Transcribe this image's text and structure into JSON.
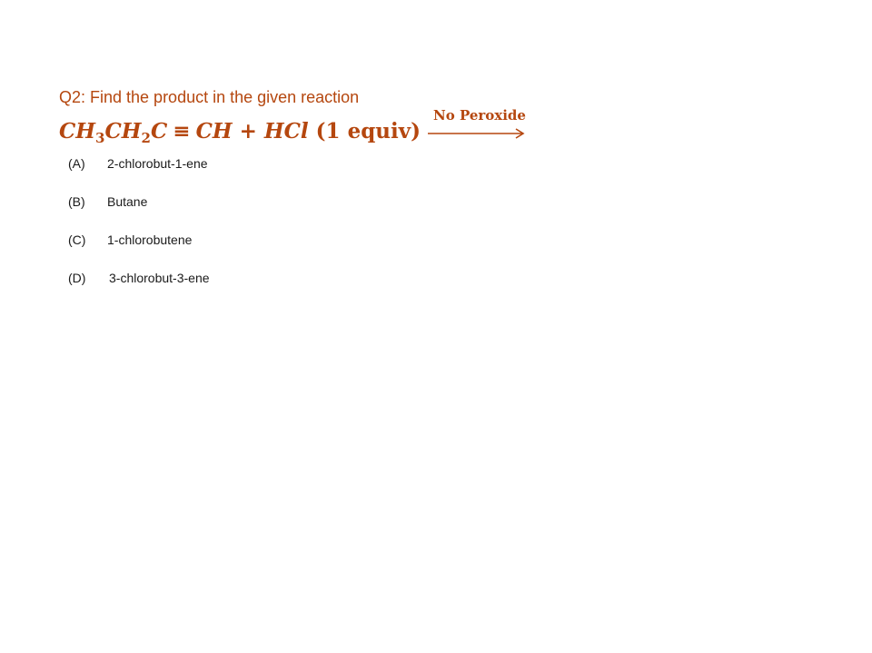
{
  "question": {
    "text": "Q2: Find the product in the given reaction"
  },
  "reaction": {
    "ch": "CH",
    "sub3": "3",
    "ch2": "CH",
    "sub2": "2",
    "c": "C",
    "triple_bond": "≡",
    "ch_end": "CH",
    "plus": "+",
    "hcl": "HCl",
    "equiv": "(1 equiv)",
    "condition": "No Peroxide"
  },
  "options": [
    {
      "letter": "(A)",
      "text": "2-chlorobut-1-ene"
    },
    {
      "letter": "(B)",
      "text": "Butane"
    },
    {
      "letter": "(C)",
      "text": "1-chlorobutene"
    },
    {
      "letter": "(D)",
      "text": "3-chlorobut-3-ene"
    }
  ],
  "colors": {
    "accent": "#b5470f",
    "text": "#1a1a1a"
  }
}
